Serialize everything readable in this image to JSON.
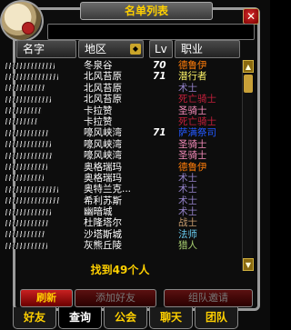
{
  "window": {
    "title": "名单列表",
    "close_label": "✕"
  },
  "search": {
    "value": ""
  },
  "columns": {
    "name": "名字",
    "zone": "地区",
    "level": "Lv",
    "class": "职业"
  },
  "rows": [
    {
      "zone": "冬泉谷",
      "level": "70",
      "class": "德鲁伊",
      "class_color": "#ff7d0a"
    },
    {
      "zone": "北风苔原",
      "level": "71",
      "class": "潜行者",
      "class_color": "#fff569"
    },
    {
      "zone": "北风苔原",
      "level": "",
      "class": "术士",
      "class_color": "#9482c9"
    },
    {
      "zone": "北风苔原",
      "level": "",
      "class": "死亡骑士",
      "class_color": "#c41f3b"
    },
    {
      "zone": "卡拉赞",
      "level": "",
      "class": "圣骑士",
      "class_color": "#f58cba"
    },
    {
      "zone": "卡拉赞",
      "level": "",
      "class": "死亡骑士",
      "class_color": "#c41f3b"
    },
    {
      "zone": "嚎风峡湾",
      "level": "71",
      "class": "萨满祭司",
      "class_color": "#2459ff"
    },
    {
      "zone": "嚎风峡湾",
      "level": "",
      "class": "圣骑士",
      "class_color": "#f58cba"
    },
    {
      "zone": "嚎风峡湾",
      "level": "",
      "class": "圣骑士",
      "class_color": "#f58cba"
    },
    {
      "zone": "奥格瑞玛",
      "level": "",
      "class": "德鲁伊",
      "class_color": "#ff7d0a"
    },
    {
      "zone": "奥格瑞玛",
      "level": "",
      "class": "术士",
      "class_color": "#9482c9"
    },
    {
      "zone": "奥特兰克...",
      "level": "",
      "class": "术士",
      "class_color": "#9482c9"
    },
    {
      "zone": "希利苏斯",
      "level": "",
      "class": "术士",
      "class_color": "#9482c9"
    },
    {
      "zone": "幽暗城",
      "level": "",
      "class": "术士",
      "class_color": "#9482c9"
    },
    {
      "zone": "杜隆塔尔",
      "level": "",
      "class": "战士",
      "class_color": "#c79c6e"
    },
    {
      "zone": "沙塔斯城",
      "level": "",
      "class": "法师",
      "class_color": "#69ccf0"
    },
    {
      "zone": "灰熊丘陵",
      "level": "",
      "class": "猎人",
      "class_color": "#abd473"
    }
  ],
  "footer": {
    "found_text": "找到49个人"
  },
  "buttons": {
    "refresh": "刷新",
    "add_friend": "添加好友",
    "guild_invite": "组队邀请"
  },
  "tabs": [
    "好友",
    "查询",
    "公会",
    "聊天",
    "团队"
  ],
  "active_tab": "查询"
}
